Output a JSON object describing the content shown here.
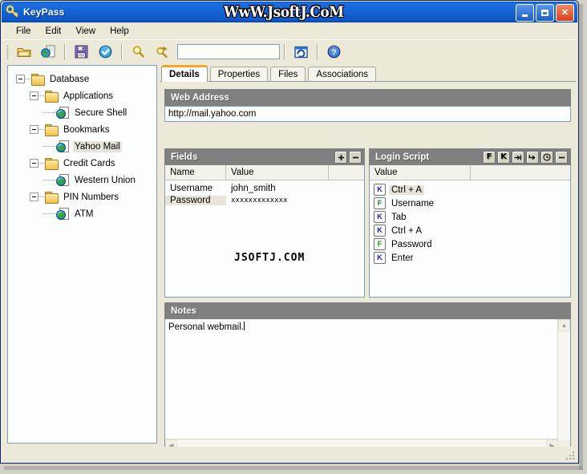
{
  "window": {
    "title": "KeyPass",
    "watermark_title": "WwW.JsoftJ.CoM",
    "watermark_body": "JSOFTJ.COM",
    "icon": "key-icon",
    "buttons": {
      "minimize": "minimize-button",
      "maximize": "maximize-button",
      "close": "close-button",
      "close_glyph": "✕"
    }
  },
  "menu": {
    "items": [
      {
        "label": "File"
      },
      {
        "label": "Edit"
      },
      {
        "label": "View"
      },
      {
        "label": "Help"
      }
    ]
  },
  "toolbar": {
    "buttons": [
      {
        "name": "open-folder-icon",
        "tooltip": "Open"
      },
      {
        "name": "new-database-icon",
        "tooltip": "New"
      },
      {
        "name": "save-icon",
        "tooltip": "Save"
      },
      {
        "name": "check-circle-icon",
        "tooltip": "Apply"
      },
      {
        "name": "search-icon",
        "tooltip": "Find"
      },
      {
        "name": "find-next-icon",
        "tooltip": "Find Next"
      },
      {
        "name": "refresh-icon",
        "tooltip": "Refresh"
      },
      {
        "name": "help-icon",
        "tooltip": "Help"
      }
    ],
    "search": {
      "value": "",
      "placeholder": ""
    }
  },
  "tree": {
    "items": [
      {
        "label": "Database",
        "level": 0,
        "icon": "folder-icon",
        "expander": "minus",
        "selected": false
      },
      {
        "label": "Applications",
        "level": 1,
        "icon": "folder-icon",
        "expander": "minus",
        "selected": false
      },
      {
        "label": "Secure Shell",
        "level": 2,
        "icon": "globe-icon",
        "expander": "none",
        "selected": false
      },
      {
        "label": "Bookmarks",
        "level": 1,
        "icon": "folder-icon",
        "expander": "minus",
        "selected": false
      },
      {
        "label": "Yahoo Mail",
        "level": 2,
        "icon": "globe-icon",
        "expander": "none",
        "selected": true
      },
      {
        "label": "Credit Cards",
        "level": 1,
        "icon": "folder-icon",
        "expander": "minus",
        "selected": false
      },
      {
        "label": "Western Union",
        "level": 2,
        "icon": "globe-icon",
        "expander": "none",
        "selected": false
      },
      {
        "label": "PIN Numbers",
        "level": 1,
        "icon": "folder-icon",
        "expander": "minus",
        "selected": false
      },
      {
        "label": "ATM",
        "level": 2,
        "icon": "globe-icon",
        "expander": "none",
        "selected": false
      }
    ]
  },
  "tabs": [
    {
      "label": "Details",
      "active": true
    },
    {
      "label": "Properties",
      "active": false
    },
    {
      "label": "Files",
      "active": false
    },
    {
      "label": "Associations",
      "active": false
    }
  ],
  "web_address": {
    "header": "Web Address",
    "value": "http://mail.yahoo.com"
  },
  "fields": {
    "header": "Fields",
    "add_label": "+",
    "remove_label": "–",
    "columns": [
      "Name",
      "Value"
    ],
    "rows": [
      {
        "name": "Username",
        "value": "john_smith",
        "masked": false,
        "selected": false
      },
      {
        "name": "Password",
        "value": "xxxxxxxxxxxxx",
        "masked": true,
        "selected": true
      }
    ]
  },
  "login_script": {
    "header": "Login Script",
    "toolbar": [
      {
        "name": "add-field-button",
        "label": "F"
      },
      {
        "name": "add-key-button",
        "label": "K"
      },
      {
        "name": "add-tab-button",
        "label": "tab-icon"
      },
      {
        "name": "add-enter-button",
        "label": "enter-icon"
      },
      {
        "name": "add-delay-button",
        "label": "clock-icon"
      },
      {
        "name": "remove-step-button",
        "label": "–"
      }
    ],
    "columns": [
      "Value"
    ],
    "rows": [
      {
        "badge": "K",
        "text": "Ctrl + A",
        "selected": true
      },
      {
        "badge": "F",
        "text": "Username",
        "selected": false
      },
      {
        "badge": "K",
        "text": "Tab",
        "selected": false
      },
      {
        "badge": "K",
        "text": "Ctrl + A",
        "selected": false
      },
      {
        "badge": "F",
        "text": "Password",
        "selected": false
      },
      {
        "badge": "K",
        "text": "Enter",
        "selected": false
      }
    ]
  },
  "notes": {
    "header": "Notes",
    "value": "Personal webmail."
  },
  "colors": {
    "title_bar": "#1565d8",
    "section_header": "#808080",
    "tab_accent": "#f5a623",
    "window_bg": "#ece9d8",
    "list_bg": "#fbfefc",
    "selection": "#e8e4da",
    "badge_key": "#1818c8",
    "badge_field": "#108c10"
  }
}
